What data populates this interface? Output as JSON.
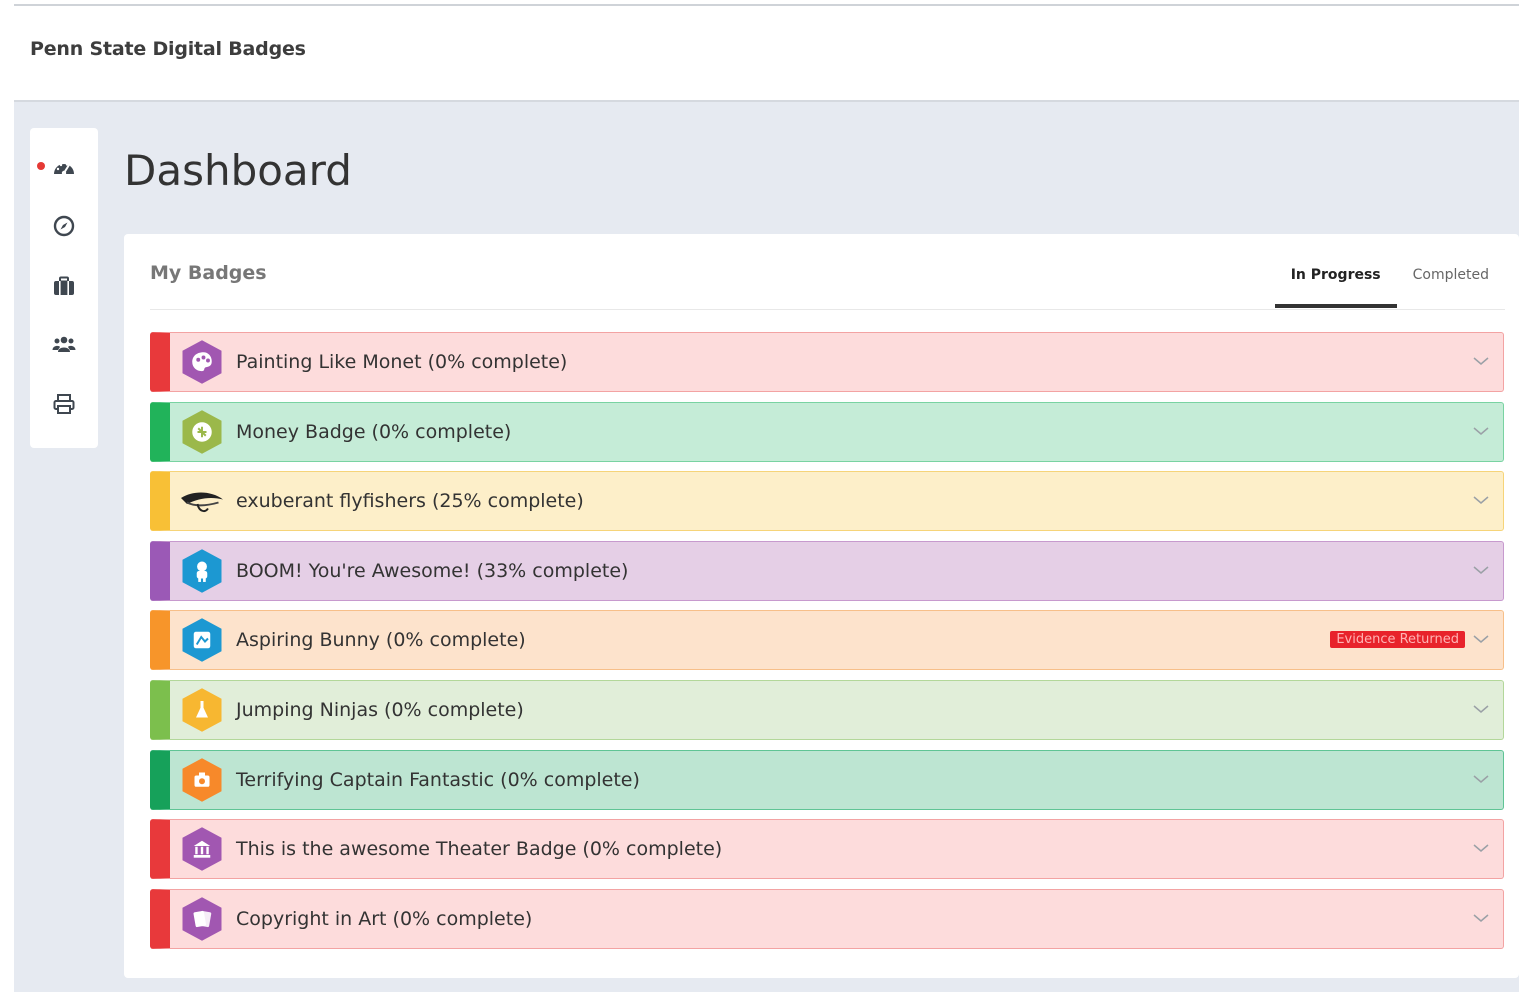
{
  "app": {
    "brand": "Penn State Digital Badges"
  },
  "sidebar": {
    "items": [
      {
        "icon": "dashboard-icon",
        "active": true
      },
      {
        "icon": "compass-icon",
        "active": false
      },
      {
        "icon": "briefcase-icon",
        "active": false
      },
      {
        "icon": "users-icon",
        "active": false
      },
      {
        "icon": "print-icon",
        "active": false
      }
    ]
  },
  "page": {
    "title": "Dashboard"
  },
  "card": {
    "title": "My Badges",
    "tabs": [
      {
        "label": "In Progress",
        "active": true
      },
      {
        "label": "Completed",
        "active": false
      }
    ]
  },
  "badges": [
    {
      "name": "Painting Like Monet (0% complete)",
      "icon": "palette-icon",
      "accent": "#e8393b",
      "bg": "#fddcdc",
      "border": "#f3a3a3",
      "iconColor": "#a157b1"
    },
    {
      "name": "Money Badge (0% complete)",
      "icon": "coin-icon",
      "accent": "#21b35a",
      "bg": "#c5ecd7",
      "border": "#79d3a2",
      "iconColor": "#9bb84a"
    },
    {
      "name": "exuberant flyfishers (25% complete)",
      "icon": "fishing-fly-icon",
      "accent": "#f8c036",
      "bg": "#fdefc9",
      "border": "#f6d479",
      "iconColor": "#333333"
    },
    {
      "name": "BOOM! You're Awesome! (33% complete)",
      "icon": "astronaut-icon",
      "accent": "#9b59b6",
      "bg": "#e5cfe6",
      "border": "#c79ace",
      "iconColor": "#1c98d2"
    },
    {
      "name": "Aspiring Bunny (0% complete)",
      "icon": "bunny-icon",
      "accent": "#f7952a",
      "bg": "#fde3cc",
      "border": "#f7bf89",
      "iconColor": "#1c98d2",
      "status": "Evidence Returned"
    },
    {
      "name": "Jumping Ninjas (0% complete)",
      "icon": "flask-icon",
      "accent": "#7cbf4d",
      "bg": "#e1eed9",
      "border": "#b3d79a",
      "iconColor": "#f7b731"
    },
    {
      "name": "Terrifying Captain Fantastic (0% complete)",
      "icon": "camera-icon",
      "accent": "#16a15a",
      "bg": "#bde5d2",
      "border": "#5fc495",
      "iconColor": "#f7892a"
    },
    {
      "name": "This is the awesome Theater Badge (0% complete)",
      "icon": "museum-icon",
      "accent": "#e8393b",
      "bg": "#fddcdc",
      "border": "#f3a3a3",
      "iconColor": "#a157b1"
    },
    {
      "name": "Copyright in Art (0% complete)",
      "icon": "cards-icon",
      "accent": "#e8393b",
      "bg": "#fddcdc",
      "border": "#f3a3a3",
      "iconColor": "#a157b1"
    }
  ]
}
